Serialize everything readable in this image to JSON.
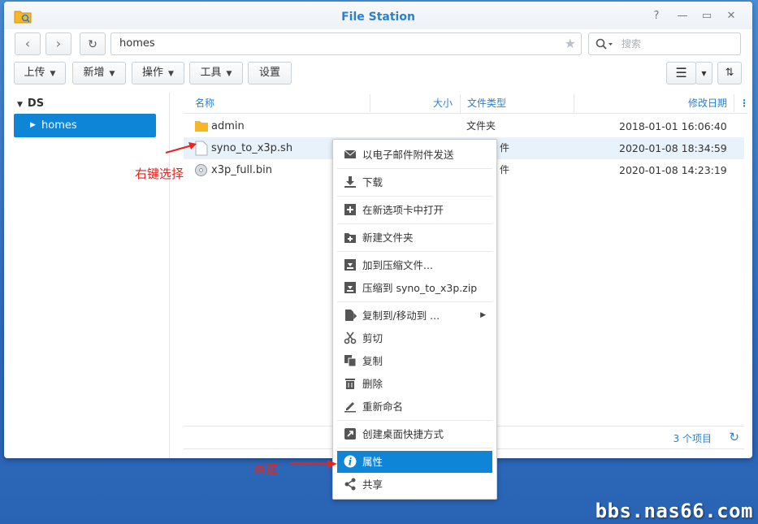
{
  "window": {
    "title": "File Station"
  },
  "nav": {
    "path": "homes",
    "search_placeholder": "搜索"
  },
  "toolbar": {
    "upload": "上传",
    "new": "新增",
    "action": "操作",
    "tools": "工具",
    "settings": "设置"
  },
  "sidebar": {
    "root": "DS",
    "items": [
      {
        "label": "homes"
      }
    ]
  },
  "columns": {
    "name": "名称",
    "size": "大小",
    "type": "文件类型",
    "modified": "修改日期"
  },
  "files": [
    {
      "name": "admin",
      "type": "文件夹",
      "modified": "2018-01-01 16:06:40"
    },
    {
      "name": "syno_to_x3p.sh",
      "type": "件",
      "modified": "2020-01-08 18:34:59"
    },
    {
      "name": "x3p_full.bin",
      "type": "件",
      "modified": "2020-01-08 14:23:19"
    }
  ],
  "status": {
    "count": "3 个项目"
  },
  "context_menu": [
    {
      "label": "以电子邮件附件发送",
      "icon": "mail-icon"
    },
    {
      "label": "下载",
      "icon": "download-icon"
    },
    {
      "label": "在新选项卡中打开",
      "icon": "new-tab-icon"
    },
    {
      "label": "新建文件夹",
      "icon": "new-folder-icon"
    },
    {
      "label": "加到压缩文件...",
      "icon": "archive-icon"
    },
    {
      "label": "压缩到 syno_to_x3p.zip",
      "icon": "archive-icon"
    },
    {
      "label": "复制到/移动到 ...",
      "icon": "copy-move-icon"
    },
    {
      "label": "剪切",
      "icon": "scissors-icon"
    },
    {
      "label": "复制",
      "icon": "copy-icon"
    },
    {
      "label": "删除",
      "icon": "trash-icon"
    },
    {
      "label": "重新命名",
      "icon": "rename-icon"
    },
    {
      "label": "创建桌面快捷方式",
      "icon": "shortcut-icon"
    },
    {
      "label": "属性",
      "icon": "info-icon"
    },
    {
      "label": "共享",
      "icon": "share-icon"
    }
  ],
  "annotations": {
    "right_click": "右键选择",
    "click_here": "点这"
  },
  "watermark": "bbs.nas66.com",
  "colors": {
    "accent": "#0f85d8",
    "annotation": "#e8231c"
  }
}
